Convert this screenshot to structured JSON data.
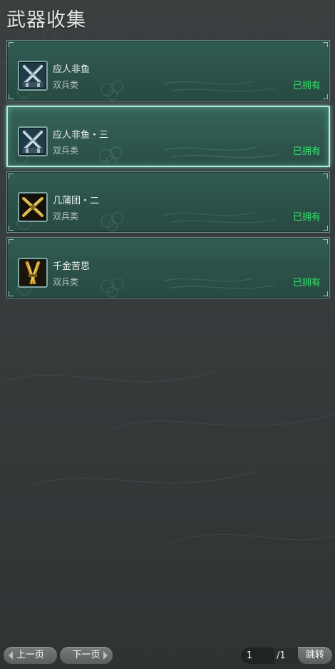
{
  "header": {
    "title": "武器收集"
  },
  "weapons": [
    {
      "name": "应人非鱼",
      "type": "双兵类",
      "status": "已拥有",
      "icon": "crossed-silver-blades-icon",
      "selected": false
    },
    {
      "name": "应人非鱼・三",
      "type": "双兵类",
      "status": "已拥有",
      "icon": "crossed-silver-blades-icon",
      "selected": true
    },
    {
      "name": "几蒲团・二",
      "type": "双兵类",
      "status": "已拥有",
      "icon": "crossed-gold-blades-icon",
      "selected": false
    },
    {
      "name": "千金苦思",
      "type": "双兵类",
      "status": "已拥有",
      "icon": "twin-gold-blades-icon",
      "selected": false
    }
  ],
  "pager": {
    "prev_label": "上一页",
    "next_label": "下一页",
    "current_page": "1",
    "total_pages": "/1",
    "jump_label": "跳转"
  },
  "colors": {
    "owned": "#35e06a",
    "card_bg": "#2e564d",
    "selected_border": "#a6f0e2"
  }
}
